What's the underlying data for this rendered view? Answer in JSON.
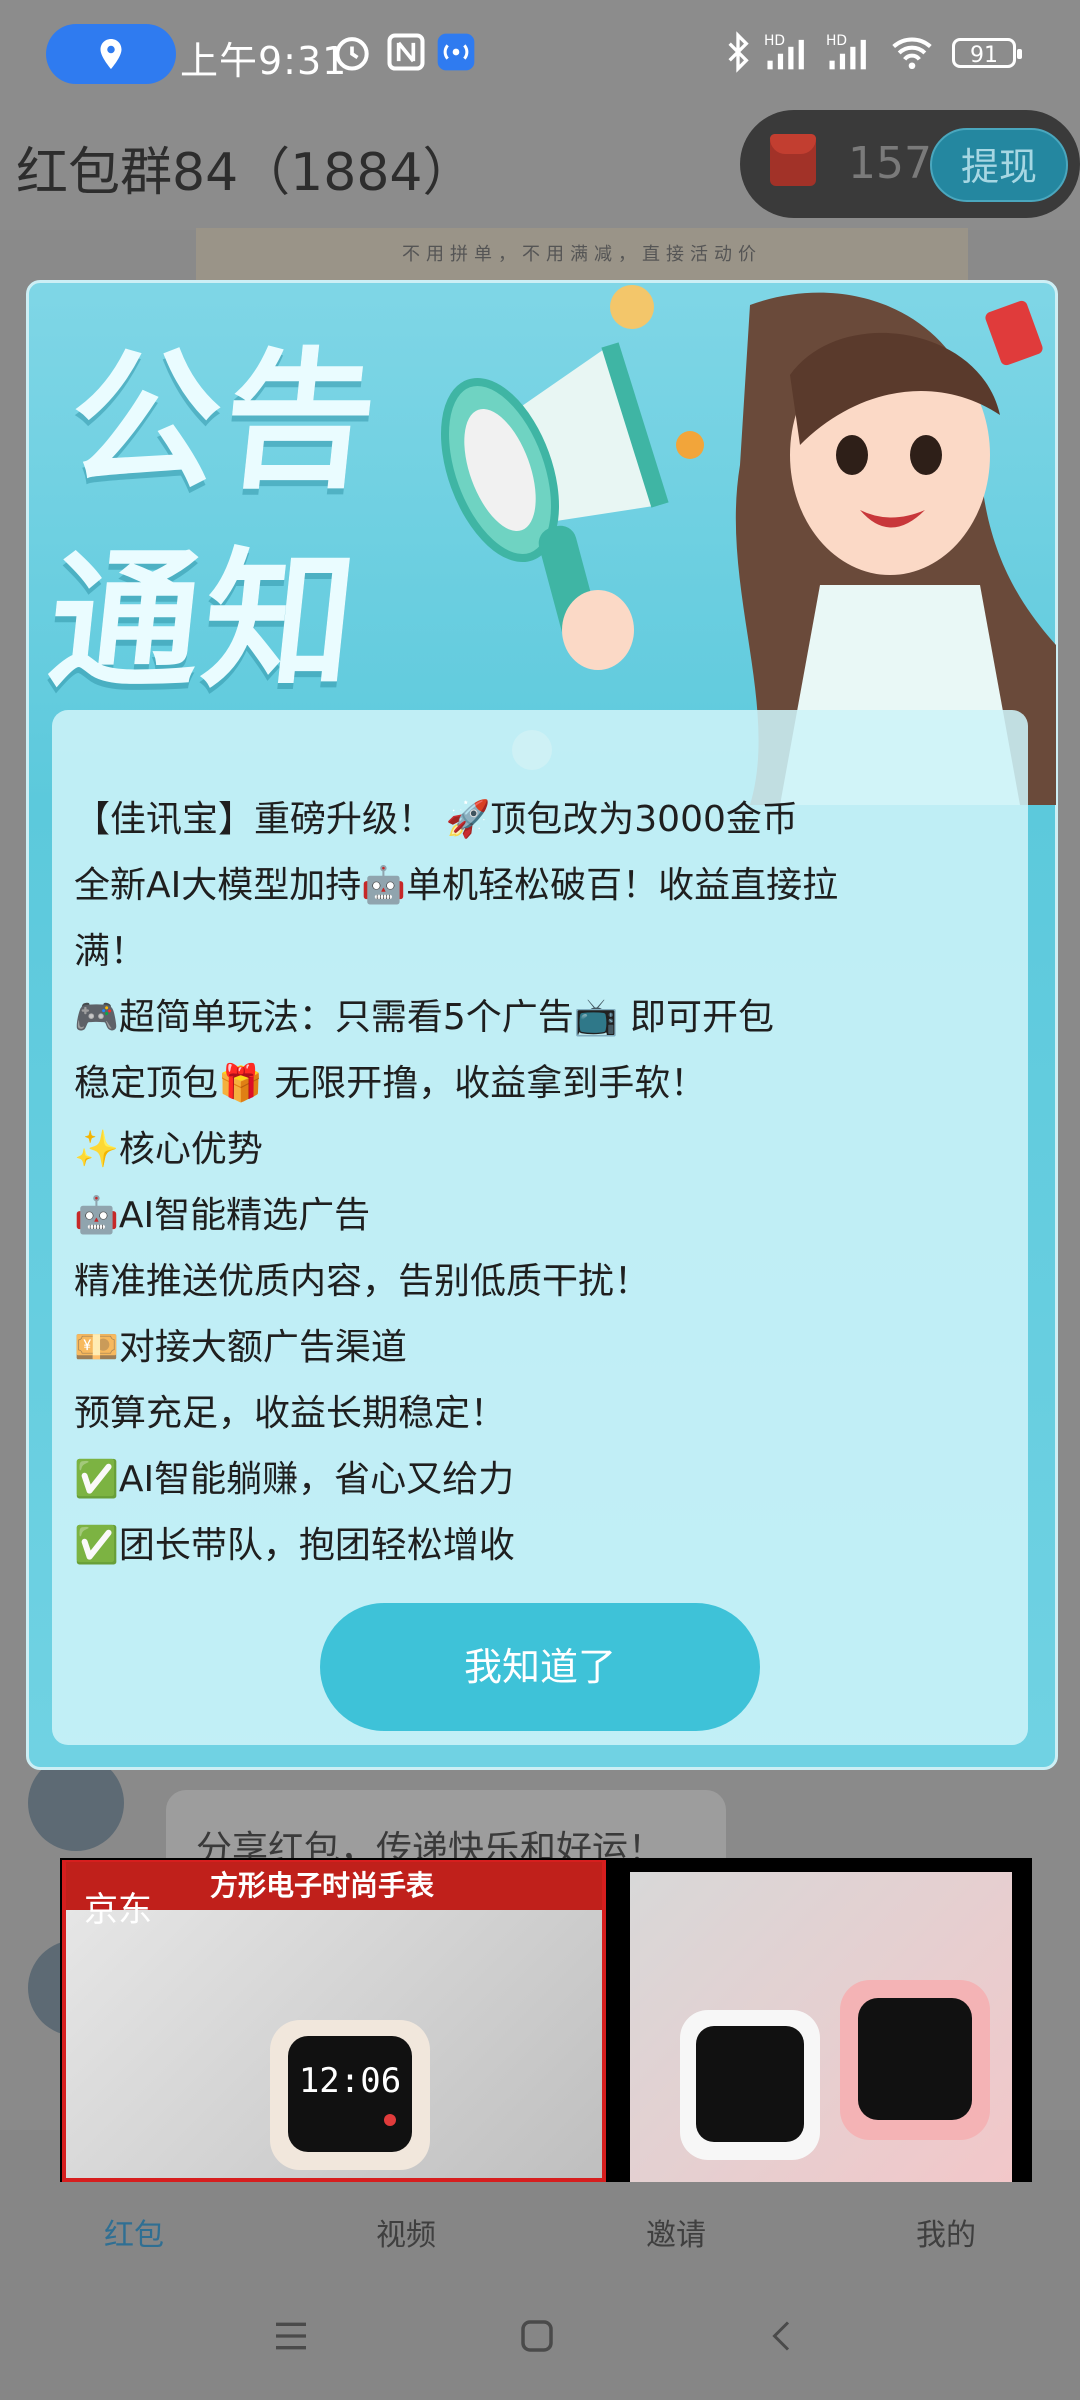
{
  "status_bar": {
    "time": "上午9:31",
    "battery": "91",
    "icons": [
      "location-icon",
      "alarm-icon",
      "nfc-icon",
      "hotspot-icon",
      "bluetooth-icon",
      "signal-hd-icon",
      "signal-hd-icon",
      "wifi-icon",
      "battery-icon"
    ]
  },
  "header": {
    "title": "红包群84（1884）",
    "coin_count": "157",
    "withdraw_label": "提现"
  },
  "background": {
    "banner_text": "不用拼单，不用满减，直接活动价",
    "bubble_text": "分享红包，传递快乐和好运！"
  },
  "modal": {
    "title_line1": "公告",
    "title_line2": "通知",
    "lines": [
      "【佳讯宝】重磅升级！ 🚀顶包改为3000金币",
      "全新AI大模型加持🤖单机轻松破百！收益直接拉",
      "满！",
      "🎮超简单玩法：只需看5个广告📺 即可开包",
      "稳定顶包🎁 无限开撸，收益拿到手软！",
      "✨核心优势",
      "🤖AI智能精选广告",
      "精准推送优质内容，告别低质干扰！",
      "💴对接大额广告渠道",
      "预算充足，收益长期稳定！",
      "✅AI智能躺赚，省心又给力",
      "✅团长带队，抱团轻松增收"
    ],
    "ack_label": "我知道了"
  },
  "ad": {
    "source": "京东",
    "banner": "方形电子时尚手表",
    "watch_time": "12:06"
  },
  "bottom_nav": {
    "items": [
      {
        "label": "红包",
        "icon": "red-packet-icon"
      },
      {
        "label": "视频",
        "icon": "video-icon"
      },
      {
        "label": "邀请",
        "icon": "invite-icon"
      },
      {
        "label": "我的",
        "icon": "profile-icon"
      }
    ]
  },
  "colors": {
    "modal_bg": "#5cc9dc",
    "ack_button": "#3ec2d8",
    "withdraw_button": "#2487a0",
    "overlay_dim": "#8c8c8c",
    "ad_accent": "#c0201b"
  }
}
